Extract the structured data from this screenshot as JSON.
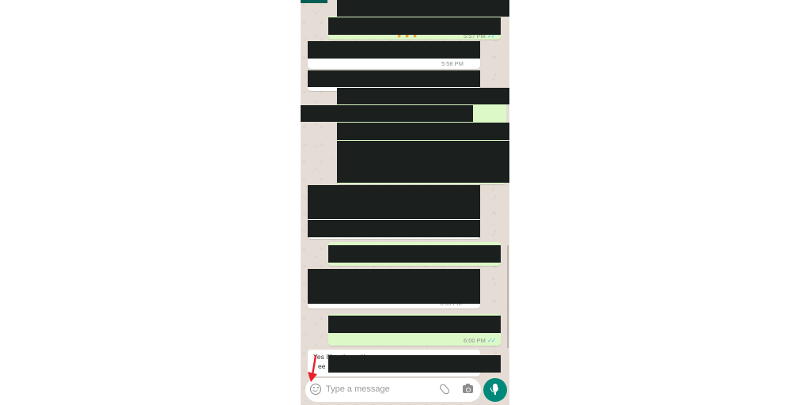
{
  "chat": {
    "messages": [
      {
        "direction": "outgoing",
        "time": "5:57 PM",
        "read": true
      },
      {
        "direction": "incoming",
        "time": "5:58 PM"
      },
      {
        "direction": "incoming"
      },
      {
        "direction": "outgoing"
      },
      {
        "direction": "incoming"
      },
      {
        "direction": "outgoing"
      },
      {
        "direction": "incoming",
        "time": "6:00 PM"
      },
      {
        "direction": "outgoing",
        "time": "6:00 PM",
        "read": true
      },
      {
        "direction": "incoming",
        "partial_text": [
          "Yes I'll ... the ... it's",
          "ee"
        ]
      }
    ],
    "read_ticks": "✓✓",
    "emoji_peek": "● ● ●"
  },
  "composer": {
    "placeholder": "Type a message"
  },
  "icons": {
    "emoji": "emoji-icon",
    "attach": "paperclip-icon",
    "camera": "camera-icon",
    "mic": "mic-icon",
    "annotation": "red-arrow"
  },
  "colors": {
    "header": "#075e54",
    "chat_background": "#e5ddd5",
    "incoming_bubble": "#ffffff",
    "outgoing_bubble": "#dcf8c6",
    "mic_button": "#00897b",
    "read_ticks": "#4fc3f7",
    "redaction": "#1b1f1e",
    "annotation_arrow": "#e8212b"
  }
}
